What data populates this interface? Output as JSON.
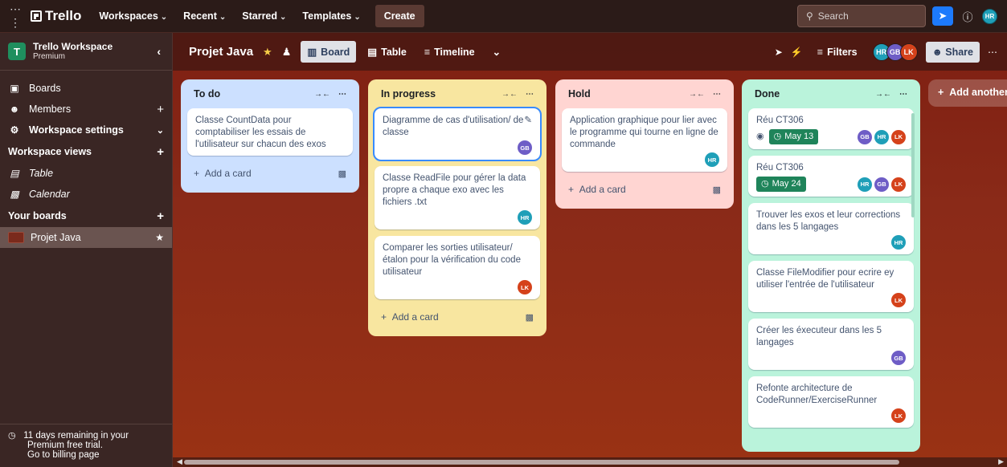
{
  "topnav": {
    "logo": "Trello",
    "items": [
      {
        "label": "Workspaces"
      },
      {
        "label": "Recent"
      },
      {
        "label": "Starred"
      },
      {
        "label": "Templates"
      }
    ],
    "create": "Create",
    "search_placeholder": "Search",
    "user_initials": "HR"
  },
  "sidebar": {
    "workspace_initial": "T",
    "workspace_name": "Trello Workspace",
    "workspace_plan": "Premium",
    "nav": [
      {
        "label": "Boards"
      },
      {
        "label": "Members"
      },
      {
        "label": "Workspace settings"
      }
    ],
    "views_title": "Workspace views",
    "views": [
      {
        "label": "Table"
      },
      {
        "label": "Calendar"
      }
    ],
    "your_boards_title": "Your boards",
    "boards": [
      {
        "label": "Projet Java"
      }
    ],
    "trial_line1": "11 days remaining in your",
    "trial_line2": "Premium free trial.",
    "trial_link": "Go to billing page"
  },
  "boardbar": {
    "title": "Projet Java",
    "views": [
      {
        "label": "Board"
      },
      {
        "label": "Table"
      },
      {
        "label": "Timeline"
      }
    ],
    "filters": "Filters",
    "members": [
      "HR",
      "GB",
      "LK"
    ],
    "share": "Share"
  },
  "lists": [
    {
      "title": "To do",
      "cards": [
        {
          "text": "Classe CountData pour comptabiliser les essais de l'utilisateur sur chacun des exos",
          "members": []
        }
      ],
      "add_label": "Add a card"
    },
    {
      "title": "In progress",
      "cards": [
        {
          "text": "Diagramme de cas d'utilisation/ de classe",
          "members": [
            "GB"
          ]
        },
        {
          "text": "Classe ReadFile pour gérer la data propre a chaque exo avec les fichiers .txt",
          "members": [
            "HR"
          ]
        },
        {
          "text": "Comparer les sorties utilisateur/ étalon pour la vérification du code utilisateur",
          "members": [
            "LK"
          ]
        }
      ],
      "add_label": "Add a card"
    },
    {
      "title": "Hold",
      "cards": [
        {
          "text": "Application graphique pour lier avec le programme qui tourne en ligne de commande",
          "members": [
            "HR"
          ]
        }
      ],
      "add_label": "Add a card"
    },
    {
      "title": "Done",
      "cards": [
        {
          "text": "Réu CT306",
          "date": "May 13",
          "watch": true,
          "members": [
            "GB",
            "HR",
            "LK"
          ]
        },
        {
          "text": "Réu CT306",
          "date": "May 24",
          "members": [
            "HR",
            "GB",
            "LK"
          ]
        },
        {
          "text": "Trouver les exos et leur corrections dans les 5 langages",
          "members": [
            "HR"
          ]
        },
        {
          "text": "Classe FileModifier pour ecrire ey utiliser l'entrée de l'utilisateur",
          "members": [
            "LK"
          ]
        },
        {
          "text": "Créer les éxecuteur dans les 5 langages",
          "members": [
            "GB"
          ]
        },
        {
          "text": "Refonte architecture de CodeRunner/ExerciseRunner",
          "members": [
            "LK"
          ]
        }
      ]
    }
  ],
  "add_list": "Add another list",
  "colors": {
    "GB": "#6e5dc6",
    "HR": "#1f9fb8",
    "LK": "#d5421b"
  }
}
